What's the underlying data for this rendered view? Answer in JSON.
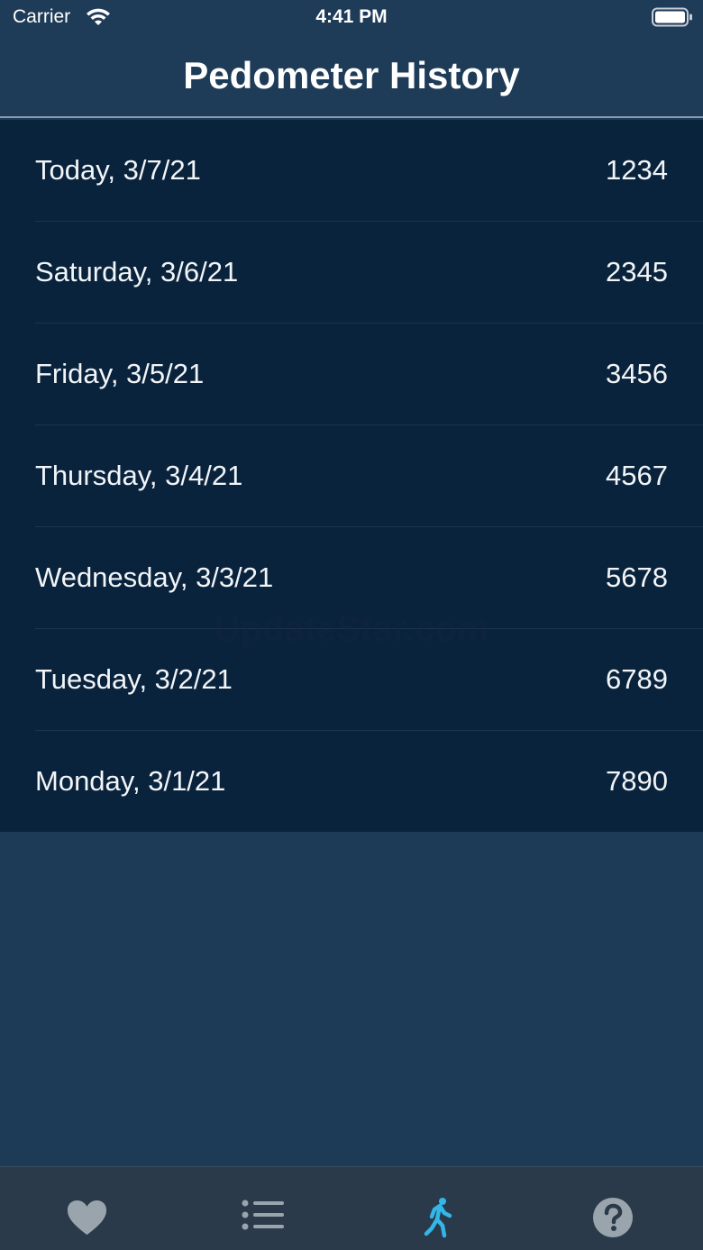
{
  "status_bar": {
    "carrier": "Carrier",
    "time": "4:41 PM"
  },
  "nav": {
    "title": "Pedometer History"
  },
  "history": [
    {
      "date": "Today, 3/7/21",
      "steps": "1234"
    },
    {
      "date": "Saturday, 3/6/21",
      "steps": "2345"
    },
    {
      "date": "Friday, 3/5/21",
      "steps": "3456"
    },
    {
      "date": "Thursday, 3/4/21",
      "steps": "4567"
    },
    {
      "date": "Wednesday, 3/3/21",
      "steps": "5678"
    },
    {
      "date": "Tuesday, 3/2/21",
      "steps": "6789"
    },
    {
      "date": "Monday, 3/1/21",
      "steps": "7890"
    }
  ],
  "watermark": "UpdateStar.com",
  "tab_bar": {
    "tabs": [
      {
        "icon": "heart-icon",
        "active": false
      },
      {
        "icon": "list-icon",
        "active": false
      },
      {
        "icon": "walking-figure-icon",
        "active": true
      },
      {
        "icon": "help-icon",
        "active": false
      }
    ],
    "active_color": "#34b7e8",
    "inactive_color": "#9aa4ad"
  },
  "colors": {
    "background": "#1d3a57",
    "list_background": "#0a233c",
    "tab_bar_background": "#2a3a4a"
  }
}
